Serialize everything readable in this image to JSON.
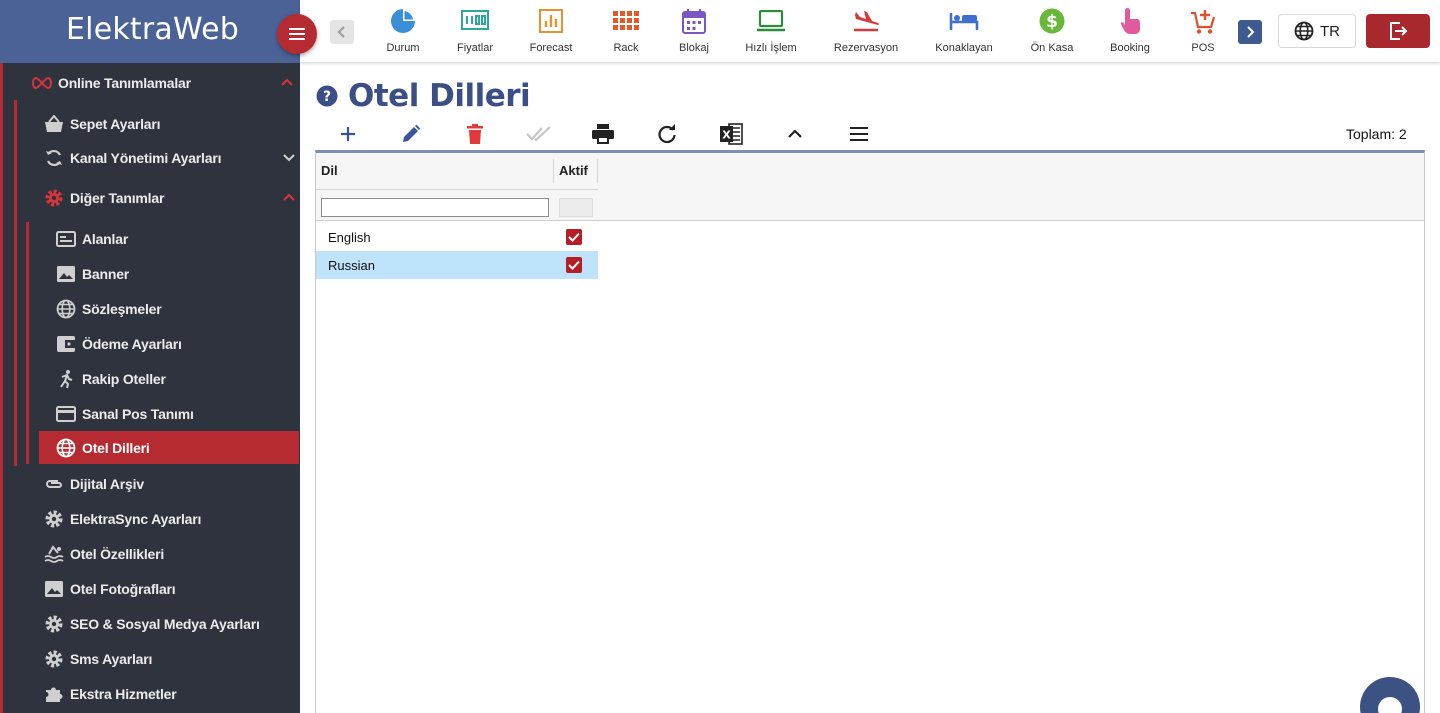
{
  "app": {
    "brand": "ElektraWeb"
  },
  "topbar": {
    "quick_actions": [
      {
        "label": "Durum",
        "icon": "pie-chart-icon",
        "color": "#3a8ed8"
      },
      {
        "label": "Fiyatlar",
        "icon": "price-board-icon",
        "color": "#2aa89a"
      },
      {
        "label": "Forecast",
        "icon": "bar-chart-icon",
        "color": "#e8912f"
      },
      {
        "label": "Rack",
        "icon": "grid-icon",
        "color": "#e05a2a"
      },
      {
        "label": "Blokaj",
        "icon": "calendar-icon",
        "color": "#7a56c2"
      },
      {
        "label": "Hızlı İşlem",
        "icon": "laptop-icon",
        "color": "#2e8b3a"
      },
      {
        "label": "Rezervasyon",
        "icon": "plane-landing-icon",
        "color": "#d63a3a"
      },
      {
        "label": "Konaklayan",
        "icon": "bed-icon",
        "color": "#3f6fcf"
      },
      {
        "label": "Ön Kasa",
        "icon": "dollar-coin-icon",
        "color": "#6ab83a"
      },
      {
        "label": "Booking",
        "icon": "touch-hand-icon",
        "color": "#e05aa0"
      },
      {
        "label": "POS",
        "icon": "cart-add-icon",
        "color": "#e0502a"
      }
    ],
    "language": "TR"
  },
  "sidebar": {
    "items": [
      {
        "label": "Online Tanımlamalar",
        "icon": "infinity-icon"
      },
      {
        "label": "Sepet Ayarları",
        "icon": "basket-icon"
      },
      {
        "label": "Kanal Yönetimi Ayarları",
        "icon": "sync-icon"
      },
      {
        "label": "Diğer Tanımlar",
        "icon": "gear-icon"
      },
      {
        "label": "Alanlar",
        "icon": "fields-icon"
      },
      {
        "label": "Banner",
        "icon": "image-icon"
      },
      {
        "label": "Sözleşmeler",
        "icon": "globe-icon"
      },
      {
        "label": "Ödeme Ayarları",
        "icon": "wallet-icon"
      },
      {
        "label": "Rakip Oteller",
        "icon": "runner-icon"
      },
      {
        "label": "Sanal Pos Tanımı",
        "icon": "credit-card-icon"
      },
      {
        "label": "Otel Dilleri",
        "icon": "globe-icon"
      },
      {
        "label": "Dijital Arşiv",
        "icon": "paperclip-icon"
      },
      {
        "label": "ElektraSync Ayarları",
        "icon": "gear-icon"
      },
      {
        "label": "Otel Özellikleri",
        "icon": "pool-icon"
      },
      {
        "label": "Otel Fotoğrafları",
        "icon": "image-icon"
      },
      {
        "label": "SEO & Sosyal Medya Ayarları",
        "icon": "gear-icon"
      },
      {
        "label": "Sms Ayarları",
        "icon": "gear-icon"
      },
      {
        "label": "Ekstra Hizmetler",
        "icon": "puzzle-icon"
      }
    ]
  },
  "page": {
    "title": "Otel Dilleri",
    "total_label": "Toplam: 2"
  },
  "toolbar": {
    "buttons": [
      "add-icon",
      "edit-icon",
      "delete-icon",
      "approve-icon",
      "print-icon",
      "refresh-icon",
      "excel-icon",
      "collapse-icon",
      "menu-lines-icon"
    ]
  },
  "grid": {
    "columns": [
      "Dil",
      "Aktif"
    ],
    "filter": {
      "value": ""
    },
    "rows": [
      {
        "language": "English",
        "active": true,
        "selected": false
      },
      {
        "language": "Russian",
        "active": true,
        "selected": true
      }
    ]
  },
  "colors": {
    "brand": "#4a6296",
    "accent": "#b52b31",
    "sidebar": "#2f333d",
    "selection": "#bfe3fa"
  }
}
